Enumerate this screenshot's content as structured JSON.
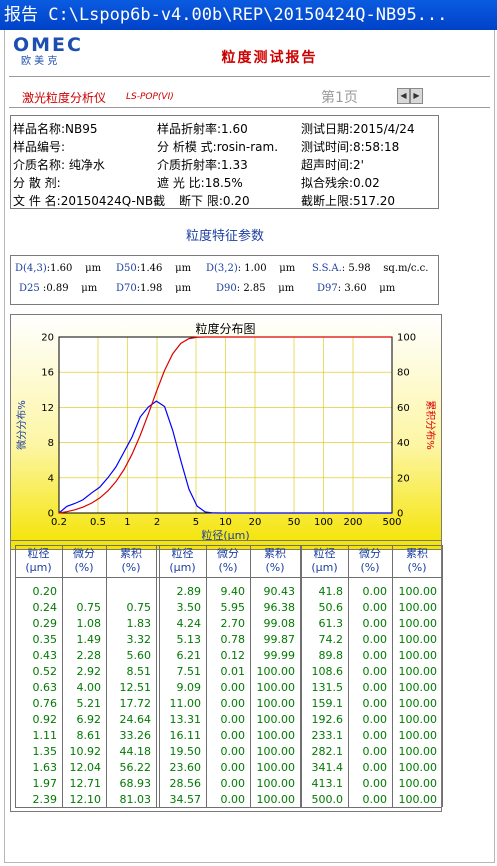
{
  "window": {
    "title": "报告 C:\\Lspop6b-v4.00b\\REP\\20150424Q-NB95..."
  },
  "logo": {
    "text": "OMEC",
    "subtitle": "欧 美 克"
  },
  "report_title": "粒度测试报告",
  "instrument": {
    "name": "激光粒度分析仪",
    "model": "LS-POP(VI)"
  },
  "pager": {
    "page_label": "第1页",
    "prev": "◀",
    "next": "▶"
  },
  "info": [
    {
      "label": "样品名称:",
      "value": "NB95"
    },
    {
      "label": "样品折射率:",
      "value": "1.60"
    },
    {
      "label": "测试日期:",
      "value": "2015/4/24"
    },
    {
      "label": "样品编号:",
      "value": ""
    },
    {
      "label": "分 析模 式:",
      "value": "rosin-ram."
    },
    {
      "label": "测试时间:",
      "value": "8:58:18"
    },
    {
      "label": "介质名称:",
      "value": "纯净水"
    },
    {
      "label": "介质折射率:",
      "value": "1.33"
    },
    {
      "label": "超声时间:",
      "value": "2'"
    },
    {
      "label": "分 散 剂:",
      "value": ""
    },
    {
      "label": "遮  光  比:",
      "value": "18.5%"
    },
    {
      "label": "拟合残余:",
      "value": "0.02"
    },
    {
      "label": "文  件  名:",
      "value": "20150424Q-NB截"
    },
    {
      "label": "断下 限:",
      "value": "0.20"
    },
    {
      "label": "截断上限:",
      "value": "517.20"
    }
  ],
  "params_title": "粒度特征参数",
  "params": [
    {
      "key": "D(4,3)",
      "value": "1.60",
      "unit": "μm"
    },
    {
      "key": "D50",
      "value": "1.46",
      "unit": "μm"
    },
    {
      "key": "D(3,2)",
      "value": "1.00",
      "unit": "μm"
    },
    {
      "key": "S.S.A.",
      "value": "5.98",
      "unit": "sq.m/c.c."
    },
    {
      "key": "D25",
      "value": "0.89",
      "unit": "μm"
    },
    {
      "key": "D70",
      "value": "1.98",
      "unit": "μm"
    },
    {
      "key": "D90",
      "value": "2.85",
      "unit": "μm"
    },
    {
      "key": "D97",
      "value": "3.60",
      "unit": "μm"
    }
  ],
  "chart_data": {
    "type": "line",
    "title": "粒度分布图",
    "xlabel": "粒径(μm)",
    "ylabel_left": "微分分布%",
    "ylabel_right": "累积分布%",
    "x_scale": "log",
    "xlim": [
      0.2,
      500
    ],
    "ylim_left": [
      0,
      20
    ],
    "ylim_right": [
      0,
      100
    ],
    "x_ticks": [
      "0.2",
      "0.5",
      "1",
      "2",
      "5",
      "10",
      "20",
      "50",
      "100",
      "200",
      "500"
    ],
    "y_ticks_left": [
      "0",
      "4",
      "8",
      "12",
      "16",
      "20"
    ],
    "y_ticks_right": [
      "0",
      "20",
      "40",
      "60",
      "80",
      "100"
    ],
    "grid": true,
    "series": [
      {
        "axis": "left",
        "color": "#0000ff",
        "x": [
          0.2,
          0.24,
          0.29,
          0.35,
          0.43,
          0.52,
          0.63,
          0.76,
          0.92,
          1.11,
          1.35,
          1.63,
          1.97,
          2.39,
          2.89,
          3.5,
          4.24,
          5.13,
          6.21,
          7.51,
          9.09
        ],
        "y": [
          0.0,
          0.75,
          1.08,
          1.49,
          2.28,
          2.92,
          4.0,
          5.21,
          6.92,
          8.61,
          10.92,
          12.04,
          12.71,
          12.1,
          9.4,
          5.95,
          2.7,
          0.78,
          0.12,
          0.01,
          0.0
        ]
      },
      {
        "axis": "right",
        "color": "#dd0000",
        "x": [
          0.2,
          0.24,
          0.29,
          0.35,
          0.43,
          0.52,
          0.63,
          0.76,
          0.92,
          1.11,
          1.35,
          1.63,
          1.97,
          2.39,
          2.89,
          3.5,
          4.24,
          5.13,
          6.21,
          7.51,
          9.09
        ],
        "y": [
          0.0,
          0.75,
          1.83,
          3.32,
          5.6,
          8.51,
          12.51,
          17.72,
          24.64,
          33.26,
          44.18,
          56.22,
          68.93,
          81.03,
          90.43,
          96.38,
          99.08,
          99.87,
          99.99,
          100.0,
          100.0
        ]
      }
    ]
  },
  "table": {
    "headers": [
      {
        "h1": "粒径",
        "h2": "(μm)"
      },
      {
        "h1": "微分",
        "h2": "(%)"
      },
      {
        "h1": "累积",
        "h2": "(%)"
      }
    ],
    "groups": [
      {
        "rows": [
          [
            "0.20",
            "",
            ""
          ],
          [
            "0.24",
            "0.75",
            "0.75"
          ],
          [
            "0.29",
            "1.08",
            "1.83"
          ],
          [
            "0.35",
            "1.49",
            "3.32"
          ],
          [
            "0.43",
            "2.28",
            "5.60"
          ],
          [
            "0.52",
            "2.92",
            "8.51"
          ],
          [
            "0.63",
            "4.00",
            "12.51"
          ],
          [
            "0.76",
            "5.21",
            "17.72"
          ],
          [
            "0.92",
            "6.92",
            "24.64"
          ],
          [
            "1.11",
            "8.61",
            "33.26"
          ],
          [
            "1.35",
            "10.92",
            "44.18"
          ],
          [
            "1.63",
            "12.04",
            "56.22"
          ],
          [
            "1.97",
            "12.71",
            "68.93"
          ],
          [
            "2.39",
            "12.10",
            "81.03"
          ]
        ]
      },
      {
        "rows": [
          [
            "2.89",
            "9.40",
            "90.43"
          ],
          [
            "3.50",
            "5.95",
            "96.38"
          ],
          [
            "4.24",
            "2.70",
            "99.08"
          ],
          [
            "5.13",
            "0.78",
            "99.87"
          ],
          [
            "6.21",
            "0.12",
            "99.99"
          ],
          [
            "7.51",
            "0.01",
            "100.00"
          ],
          [
            "9.09",
            "0.00",
            "100.00"
          ],
          [
            "11.00",
            "0.00",
            "100.00"
          ],
          [
            "13.31",
            "0.00",
            "100.00"
          ],
          [
            "16.11",
            "0.00",
            "100.00"
          ],
          [
            "19.50",
            "0.00",
            "100.00"
          ],
          [
            "23.60",
            "0.00",
            "100.00"
          ],
          [
            "28.56",
            "0.00",
            "100.00"
          ],
          [
            "34.57",
            "0.00",
            "100.00"
          ]
        ]
      },
      {
        "rows": [
          [
            "41.8",
            "0.00",
            "100.00"
          ],
          [
            "50.6",
            "0.00",
            "100.00"
          ],
          [
            "61.3",
            "0.00",
            "100.00"
          ],
          [
            "74.2",
            "0.00",
            "100.00"
          ],
          [
            "89.8",
            "0.00",
            "100.00"
          ],
          [
            "108.6",
            "0.00",
            "100.00"
          ],
          [
            "131.5",
            "0.00",
            "100.00"
          ],
          [
            "159.1",
            "0.00",
            "100.00"
          ],
          [
            "192.6",
            "0.00",
            "100.00"
          ],
          [
            "233.1",
            "0.00",
            "100.00"
          ],
          [
            "282.1",
            "0.00",
            "100.00"
          ],
          [
            "341.4",
            "0.00",
            "100.00"
          ],
          [
            "413.1",
            "0.00",
            "100.00"
          ],
          [
            "500.0",
            "0.00",
            "100.00"
          ]
        ]
      }
    ]
  }
}
